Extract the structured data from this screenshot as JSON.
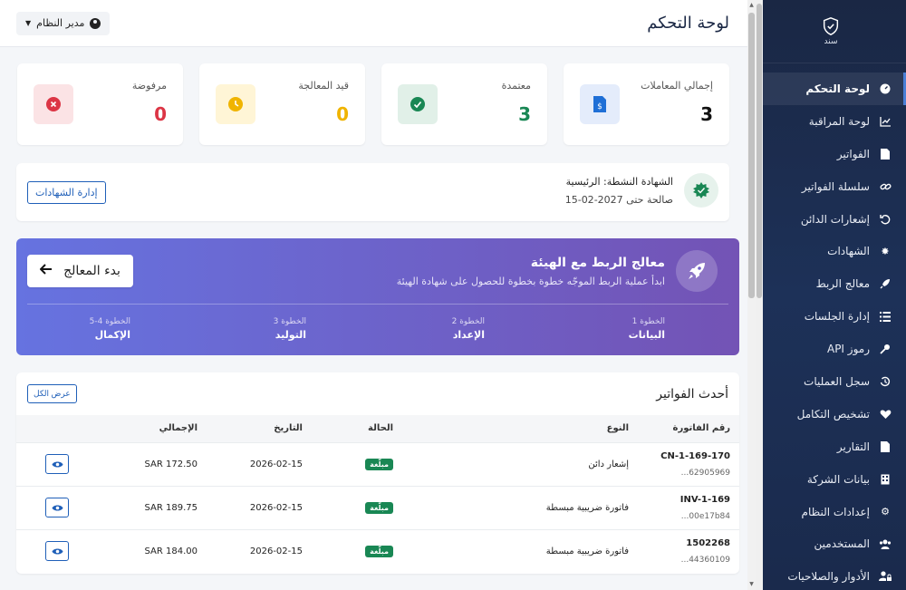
{
  "brand": {
    "logo_text": "سند"
  },
  "sidebar": {
    "items": [
      {
        "label": "لوحة التحكم",
        "icon": "gauge-icon",
        "active": true
      },
      {
        "label": "لوحة المراقبة",
        "icon": "chart-line-icon"
      },
      {
        "label": "الفواتير",
        "icon": "invoice-file-icon"
      },
      {
        "label": "سلسلة الفواتير",
        "icon": "link-icon"
      },
      {
        "label": "إشعارات الدائن",
        "icon": "undo-icon"
      },
      {
        "label": "الشهادات",
        "icon": "certificate-icon"
      },
      {
        "label": "معالج الربط",
        "icon": "rocket-icon"
      },
      {
        "label": "إدارة الجلسات",
        "icon": "list-icon"
      },
      {
        "label": "رموز API",
        "icon": "key-icon"
      },
      {
        "label": "سجل العمليات",
        "icon": "history-icon"
      },
      {
        "label": "تشخيص التكامل",
        "icon": "heart-pulse-icon"
      },
      {
        "label": "التقارير",
        "icon": "csv-file-icon"
      },
      {
        "label": "بيانات الشركة",
        "icon": "building-icon"
      },
      {
        "label": "إعدادات النظام",
        "icon": "cogs-icon"
      },
      {
        "label": "المستخدمين",
        "icon": "users-icon"
      },
      {
        "label": "الأدوار والصلاحيات",
        "icon": "user-lock-icon"
      }
    ]
  },
  "header": {
    "title": "لوحة التحكم",
    "user_label": "مدير النظام"
  },
  "stats": [
    {
      "label": "إجمالي المعاملات",
      "value": "3",
      "color": "#111111",
      "icon": "dollar-file-icon"
    },
    {
      "label": "معتمدة",
      "value": "3",
      "color": "#198754",
      "icon": "check-circle-icon"
    },
    {
      "label": "قيد المعالجة",
      "value": "0",
      "color": "#f0b400",
      "icon": "clock-icon"
    },
    {
      "label": "مرفوضة",
      "value": "0",
      "color": "#dc3545",
      "icon": "x-circle-icon"
    }
  ],
  "certificate": {
    "title": "الشهادة النشطة: الرئيسية",
    "validity": "صالحة حتى 2027-02-15",
    "manage_label": "إدارة الشهادات"
  },
  "wizard": {
    "title": "معالج الربط مع الهيئة",
    "subtitle": "ابدأ عملية الربط الموجّه خطوة بخطوة للحصول على شهادة الهيئة",
    "start_label": "بدء المعالج",
    "steps": [
      {
        "num": "الخطوة 1",
        "label": "البيانات"
      },
      {
        "num": "الخطوة 2",
        "label": "الإعداد"
      },
      {
        "num": "الخطوة 3",
        "label": "التوليد"
      },
      {
        "num": "الخطوة 4-5",
        "label": "الإكمال"
      }
    ]
  },
  "invoices": {
    "title": "أحدث الفواتير",
    "view_all_label": "عرض الكل",
    "columns": [
      "رقم الفاتورة",
      "النوع",
      "الحالة",
      "التاريخ",
      "الإجمالي"
    ],
    "rows": [
      {
        "number": "CN-1-169-170",
        "id": "62905969...",
        "type": "إشعار دائن",
        "status": "مبلّغة",
        "date": "2026-02-15",
        "total": "SAR 172.50"
      },
      {
        "number": "INV-1-169",
        "id": "00e17b84...",
        "type": "فاتورة ضريبية مبسطة",
        "status": "مبلّغة",
        "date": "2026-02-15",
        "total": "SAR 189.75"
      },
      {
        "number": "1502268",
        "id": "44360109...",
        "type": "فاتورة ضريبية مبسطة",
        "status": "مبلّغة",
        "date": "2026-02-15",
        "total": "SAR 184.00"
      }
    ]
  }
}
